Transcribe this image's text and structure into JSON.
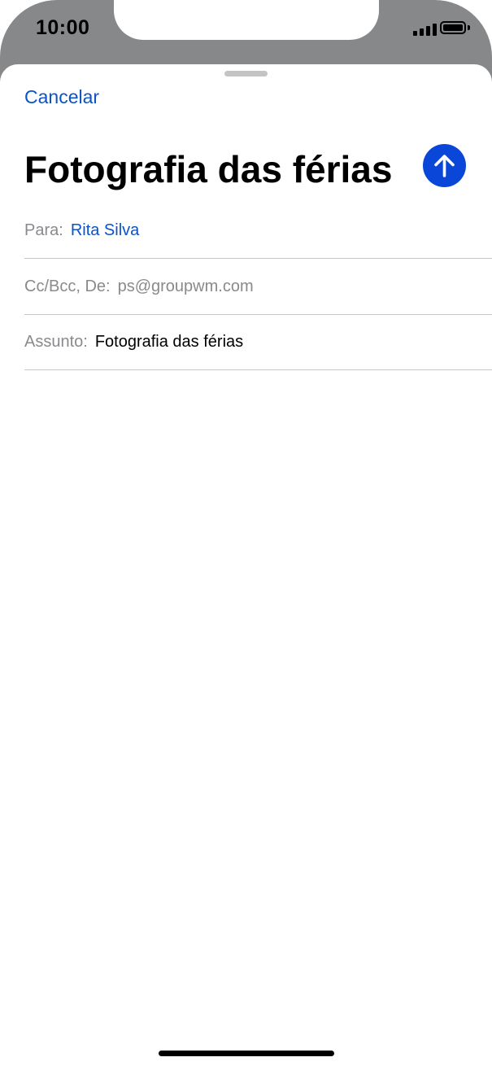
{
  "status_bar": {
    "time": "10:00"
  },
  "compose": {
    "cancel_label": "Cancelar",
    "title": "Fotografia das férias",
    "send_icon": "arrow-up-icon",
    "accent_color": "#0a47d8",
    "fields": {
      "to": {
        "label": "Para:",
        "value": "Rita Silva"
      },
      "cc_bcc_from": {
        "label": "Cc/Bcc, De:",
        "value": "ps@groupwm.com"
      },
      "subject": {
        "label": "Assunto:",
        "value": "Fotografia das férias"
      }
    }
  }
}
